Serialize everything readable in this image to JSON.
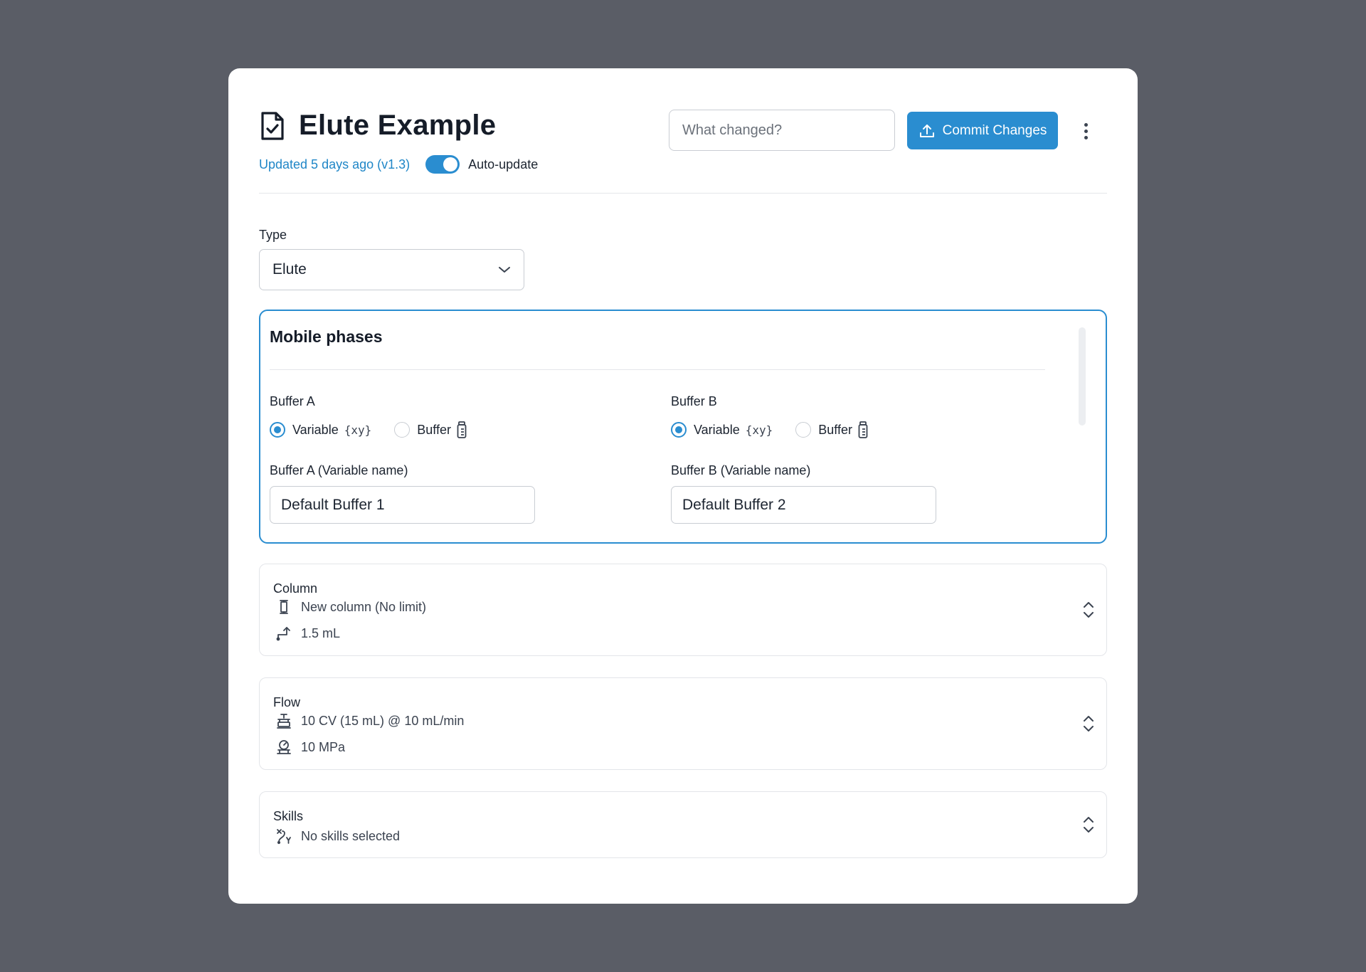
{
  "header": {
    "title": "Elute Example",
    "updated": "Updated 5 days ago (v1.3)",
    "auto_update_label": "Auto-update",
    "auto_update_on": true,
    "change_placeholder": "What changed?",
    "commit_label": "Commit Changes"
  },
  "type_field": {
    "label": "Type",
    "value": "Elute"
  },
  "mobile_phases": {
    "title": "Mobile phases",
    "buffer_a": {
      "label": "Buffer A",
      "option_variable": "Variable",
      "option_buffer": "Buffer",
      "selected": "Variable",
      "var_label": "Buffer A (Variable name)",
      "var_value": "Default Buffer 1"
    },
    "buffer_b": {
      "label": "Buffer B",
      "option_variable": "Variable",
      "option_buffer": "Buffer",
      "selected": "Variable",
      "var_label": "Buffer B (Variable name)",
      "var_value": "Default Buffer 2"
    },
    "xy_glyph": "{xy}"
  },
  "column": {
    "title": "Column",
    "lines": [
      "New column (No limit)",
      "1.5 mL"
    ]
  },
  "flow": {
    "title": "Flow",
    "lines": [
      "10 CV (15 mL) @ 10 mL/min",
      "10 MPa"
    ]
  },
  "skills": {
    "title": "Skills",
    "lines": [
      "No skills selected"
    ]
  },
  "colors": {
    "accent": "#2a8dd0",
    "link": "#1f86c7",
    "backdrop": "#5a5d66"
  }
}
